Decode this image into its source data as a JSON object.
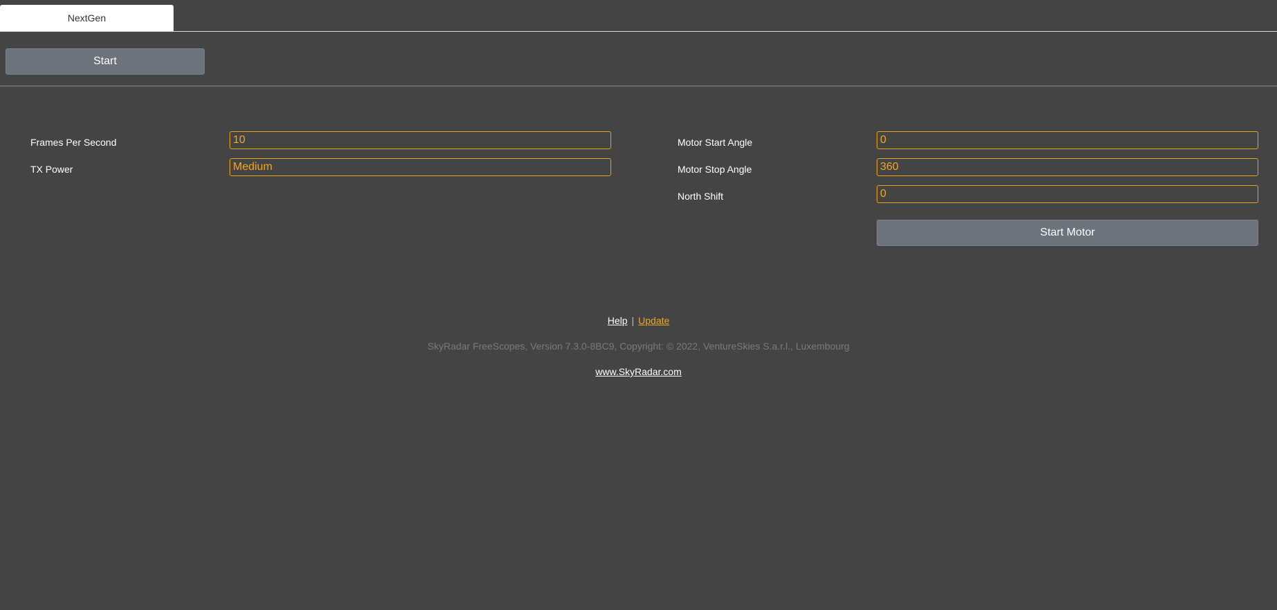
{
  "tabs": [
    {
      "label": "NextGen"
    }
  ],
  "toolbar": {
    "start_label": "Start"
  },
  "settings_left": {
    "fps": {
      "label": "Frames Per Second",
      "value": "10"
    },
    "tx_power": {
      "label": "TX Power",
      "value": "Medium"
    }
  },
  "settings_right": {
    "motor_start_angle": {
      "label": "Motor Start Angle",
      "value": "0"
    },
    "motor_stop_angle": {
      "label": "Motor Stop Angle",
      "value": "360"
    },
    "north_shift": {
      "label": "North Shift",
      "value": "0"
    },
    "start_motor_label": "Start Motor"
  },
  "footer": {
    "help_label": "Help",
    "separator": "|",
    "update_label": "Update",
    "copyright": "SkyRadar FreeScopes, Version 7.3.0-8BC9, Copyright: © 2022, VentureSkies S.a.r.l., Luxembourg",
    "website": "www.SkyRadar.com"
  },
  "colors": {
    "background": "#444444",
    "accent": "#f0a626",
    "button": "#6c737c"
  }
}
